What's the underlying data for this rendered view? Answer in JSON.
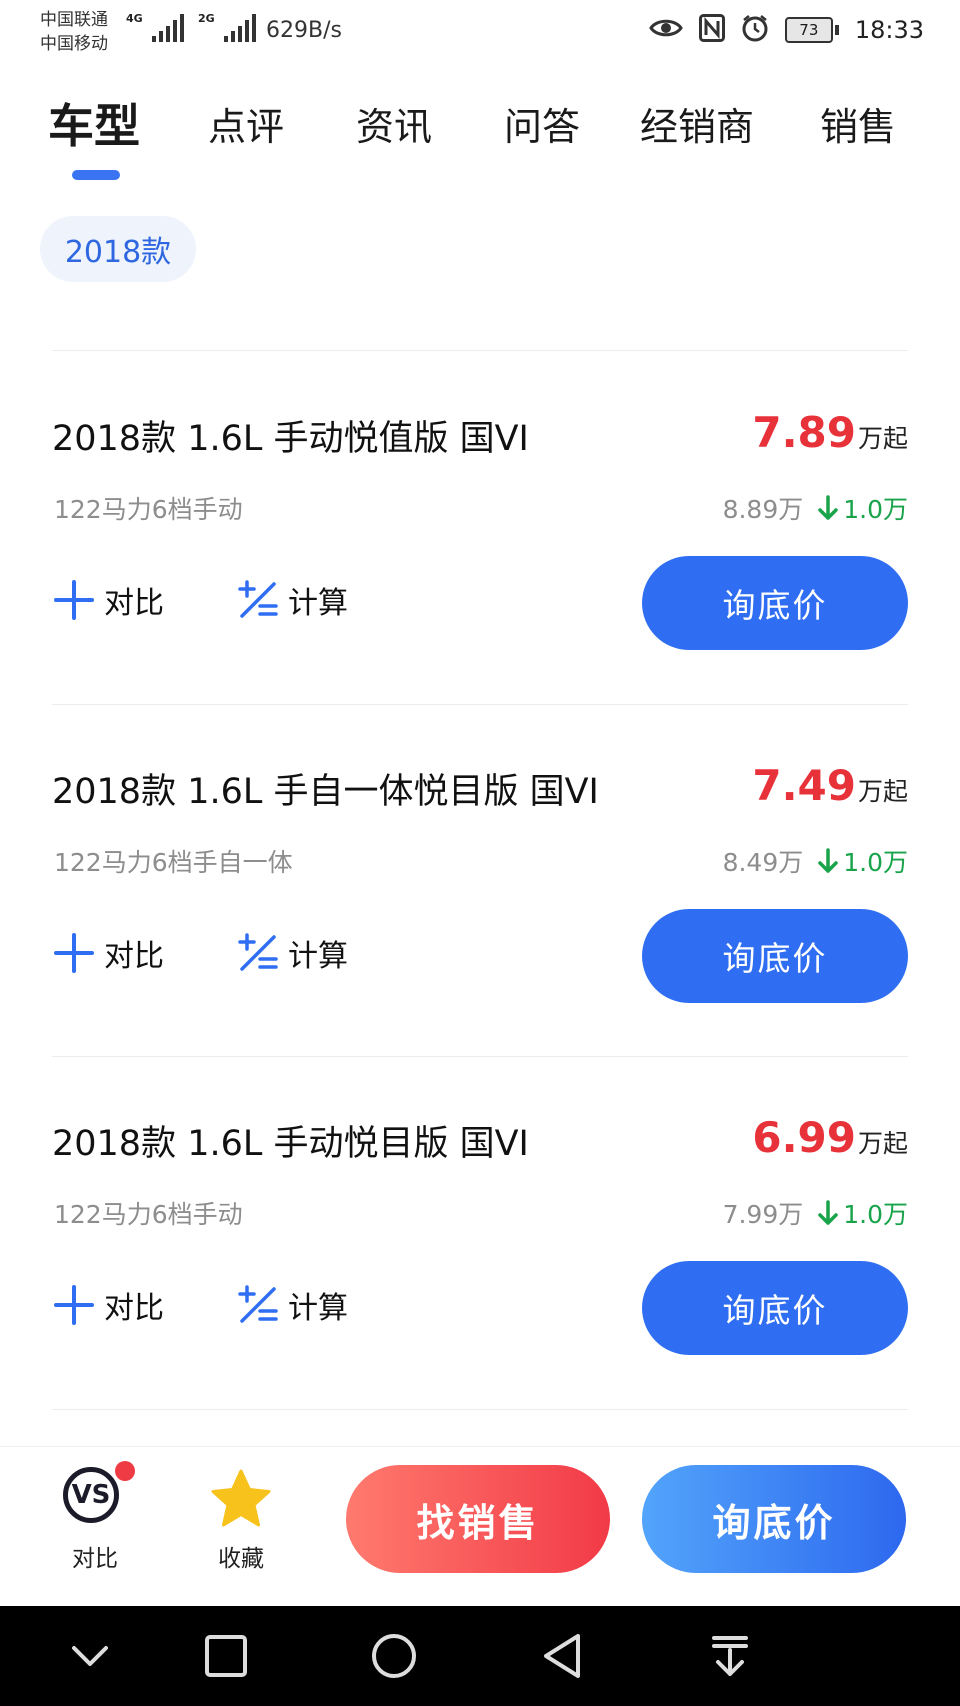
{
  "status_bar": {
    "carrier_1": "中国联通",
    "carrier_2": "中国移动",
    "net_1": "4G",
    "net_2": "2G",
    "speed": "629B/s",
    "battery": "73",
    "time": "18:33"
  },
  "tabs": [
    {
      "label": "车型",
      "active": true
    },
    {
      "label": "点评",
      "active": false
    },
    {
      "label": "资讯",
      "active": false
    },
    {
      "label": "问答",
      "active": false
    },
    {
      "label": "经销商",
      "active": false
    },
    {
      "label": "销售",
      "active": false
    }
  ],
  "year_filter": "2018款",
  "models": [
    {
      "title": "2018款 1.6L 手动悦值版 国VI",
      "spec": "122马力6档手动",
      "price": "7.89",
      "price_unit": "万起",
      "guide_price": "8.89万",
      "drop": "1.0万",
      "compare_label": "对比",
      "calc_label": "计算",
      "ask_label": "询底价"
    },
    {
      "title": "2018款 1.6L 手自一体悦目版 国VI",
      "spec": "122马力6档手自一体",
      "price": "7.49",
      "price_unit": "万起",
      "guide_price": "8.49万",
      "drop": "1.0万",
      "compare_label": "对比",
      "calc_label": "计算",
      "ask_label": "询底价"
    },
    {
      "title": "2018款 1.6L 手动悦目版 国VI",
      "spec": "122马力6档手动",
      "price": "6.99",
      "price_unit": "万起",
      "guide_price": "7.99万",
      "drop": "1.0万",
      "compare_label": "对比",
      "calc_label": "计算",
      "ask_label": "询底价"
    }
  ],
  "bottom_bar": {
    "vs_icon_text": "VS",
    "compare_label": "对比",
    "favorite_label": "收藏",
    "find_sales_label": "找销售",
    "ask_price_label": "询底价"
  },
  "colors": {
    "accent_blue": "#2f6ef2",
    "price_red": "#e8323a",
    "drop_green": "#19a34a",
    "star_yellow": "#f7c21b"
  }
}
